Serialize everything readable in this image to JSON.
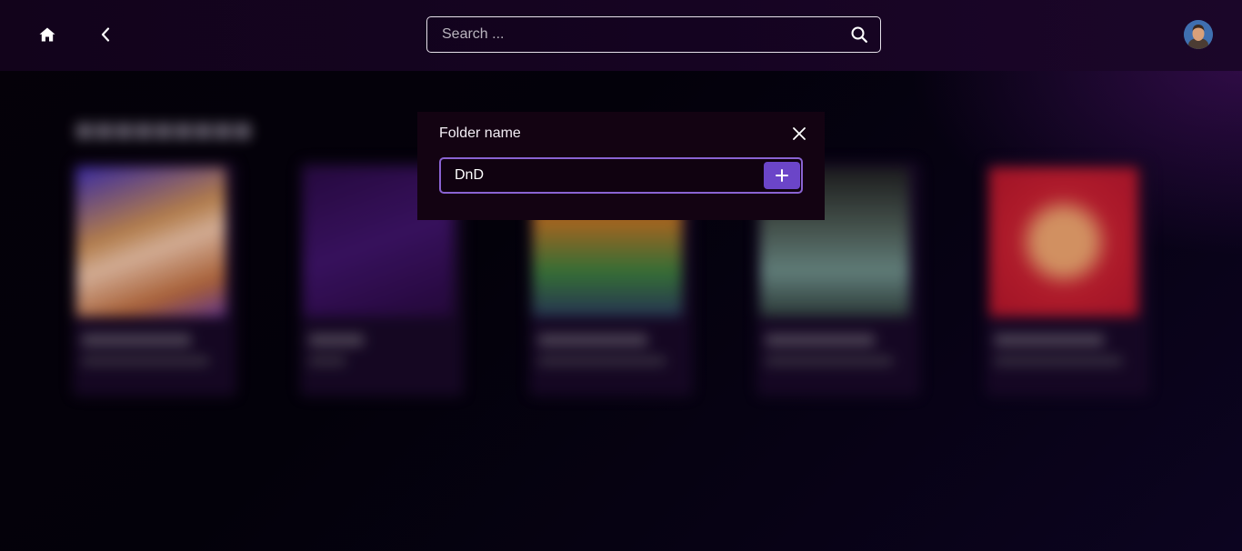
{
  "header": {
    "home_icon": "home-icon",
    "back_icon": "chevron-left-icon",
    "search": {
      "placeholder": "Search ...",
      "value": "",
      "icon": "search-icon"
    },
    "avatar_icon": "user-avatar"
  },
  "modal": {
    "title": "Folder name",
    "close_icon": "close-icon",
    "input_value": "DnD",
    "add_icon": "plus-icon"
  },
  "colors": {
    "accent": "#6b45c8",
    "accent_border": "#8a63d2",
    "modal_bg": "#130312",
    "topbar_bg": "#160422"
  }
}
